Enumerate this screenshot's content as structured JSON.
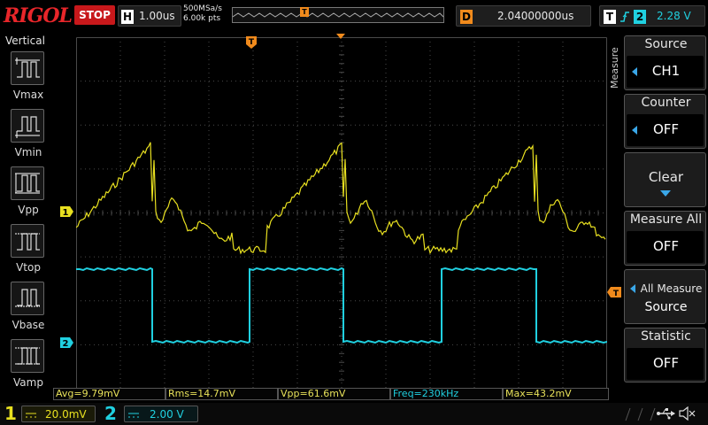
{
  "brand": {
    "logo": "RIGOL"
  },
  "topbar": {
    "run_status": "STOP",
    "timebase_key": "H",
    "timebase_value": "1.00us",
    "sample_rate": "500MSa/s",
    "memory_depth": "6.00k pts",
    "trigger_marker": "T",
    "delay_key": "D",
    "delay_value": "2.04000000us",
    "trigger_key": "T",
    "trigger_slope_icon": "rising-edge-icon",
    "trigger_source": "2",
    "trigger_level": "2.28 V"
  },
  "left_panel": {
    "title": "Vertical",
    "items": [
      {
        "label": "Vmax",
        "icon": "vmax-icon"
      },
      {
        "label": "Vmin",
        "icon": "vmin-icon"
      },
      {
        "label": "Vpp",
        "icon": "vpp-icon"
      },
      {
        "label": "Vtop",
        "icon": "vtop-icon"
      },
      {
        "label": "Vbase",
        "icon": "vbase-icon"
      },
      {
        "label": "Vamp",
        "icon": "vamp-icon"
      }
    ]
  },
  "waveform": {
    "ch1_marker": "1",
    "ch2_marker": "2",
    "trigger_marker": "T",
    "ch1_color": "#e8e020",
    "ch2_color": "#20d0e0",
    "grid_color": "#4a4a4a"
  },
  "right_menu": {
    "tab_label": "Measure",
    "items": [
      {
        "title": "Source",
        "value": "CH1"
      },
      {
        "title": "Counter",
        "value": "OFF"
      },
      {
        "title": "Clear",
        "value": ""
      },
      {
        "title": "Measure All",
        "value": "OFF"
      },
      {
        "title": "All Measure",
        "value": "Source"
      },
      {
        "title": "Statistic",
        "value": "OFF"
      }
    ]
  },
  "measurements": [
    {
      "text": "Avg=9.79mV",
      "color": "yellow"
    },
    {
      "text": "Rms=14.7mV",
      "color": "yellow"
    },
    {
      "text": "Vpp=61.6mV",
      "color": "yellow"
    },
    {
      "text": "Freq=230kHz",
      "color": "cyan"
    },
    {
      "text": "Max=43.2mV",
      "color": "yellow"
    }
  ],
  "channels": [
    {
      "number": "1",
      "scale": "20.0mV",
      "color": "#e8e020"
    },
    {
      "number": "2",
      "scale": "2.00 V",
      "color": "#20d0e0"
    }
  ],
  "status_icons": [
    "usb-icon",
    "mute-speaker-icon"
  ]
}
